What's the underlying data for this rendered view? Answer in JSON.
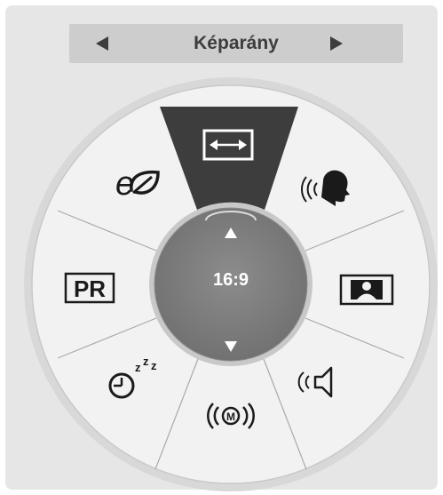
{
  "header": {
    "title": "Képarány",
    "prev_icon": "triangle-left-icon",
    "next_icon": "triangle-right-icon"
  },
  "dial": {
    "center_value": "16:9",
    "up_icon": "triangle-up-icon",
    "down_icon": "triangle-down-icon",
    "items": [
      {
        "name": "aspect-ratio",
        "icon": "double-arrow-icon",
        "selected": true
      },
      {
        "name": "clear-voice",
        "icon": "speaking-head-icon"
      },
      {
        "name": "picture-mode",
        "icon": "person-picture-icon"
      },
      {
        "name": "sound-mode",
        "icon": "speaker-icon"
      },
      {
        "name": "multi-audio",
        "icon": "m-waves-icon"
      },
      {
        "name": "sleep-timer",
        "icon": "sleep-clock-icon"
      },
      {
        "name": "pr-list",
        "icon": "pr-icon",
        "label": "PR"
      },
      {
        "name": "energy-saving",
        "icon": "eco-icon",
        "label": "e"
      }
    ]
  },
  "colors": {
    "panel_bg": "#e6e6e6",
    "titlebar_bg": "#cdcdcd",
    "selected_wedge": "#3d3d3d",
    "center_disc": "#7a7a7a",
    "icon": "#1a1a1a"
  }
}
